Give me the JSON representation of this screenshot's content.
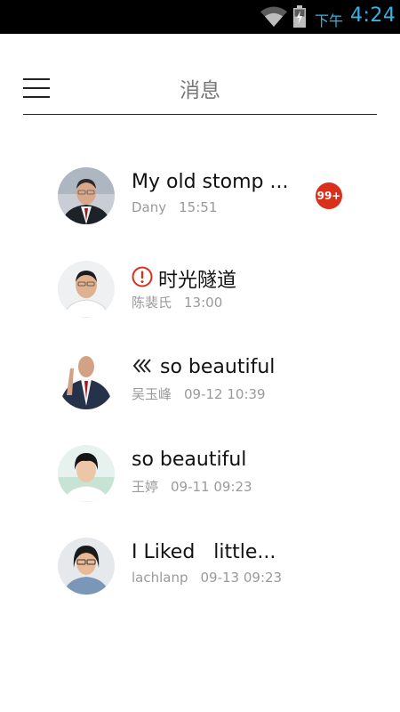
{
  "status_bar": {
    "ampm": "下午",
    "time": "4:24",
    "accent_color": "#33b5e5",
    "icons": [
      "wifi-icon",
      "battery-charging-icon"
    ]
  },
  "header": {
    "title": "消息",
    "menu_icon": "hamburger-menu-icon"
  },
  "messages": [
    {
      "title": "My old stomp ...",
      "sender": "Dany",
      "time": "15:51",
      "badge": "99+",
      "prefix_icon": ""
    },
    {
      "title": "时光隧道",
      "sender": "陈裴氏",
      "time": "13:00",
      "badge": "",
      "prefix_icon": "alert-circle-icon"
    },
    {
      "title": "so beautiful",
      "sender": "吴玉峰",
      "time": "09-12 10:39",
      "badge": "",
      "prefix_icon": "double-chevron-left-icon"
    },
    {
      "title": "so beautiful",
      "sender": "王婷",
      "time": "09-11 09:23",
      "badge": "",
      "prefix_icon": ""
    },
    {
      "title": "I Liked   little...",
      "sender": "lachlanp",
      "time": "09-13 09:23",
      "badge": "",
      "prefix_icon": ""
    }
  ],
  "colors": {
    "badge": "#d9301c",
    "alert": "#d9301c",
    "secondary_text": "#9a9a9a",
    "title_text": "#777777"
  }
}
